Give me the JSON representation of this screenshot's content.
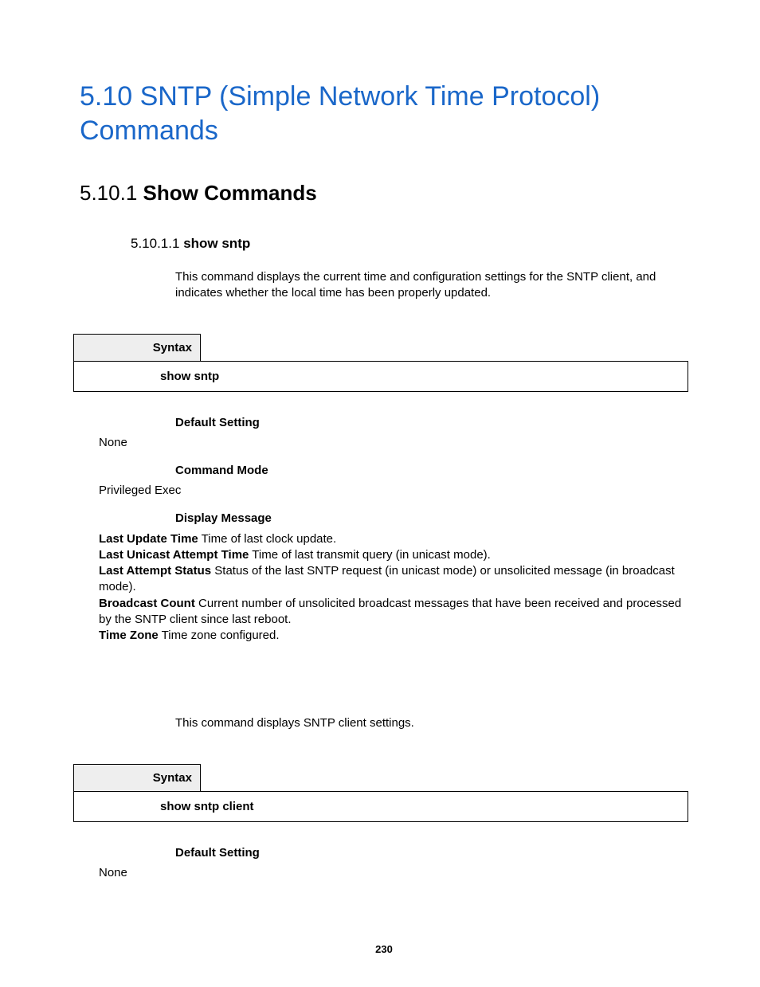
{
  "heading1": "5.10 SNTP (Simple Network Time Protocol) Commands",
  "heading2": {
    "num": "5.10.1",
    "title": "Show Commands"
  },
  "section1": {
    "heading3": {
      "num": "5.10.1.1",
      "title": "show sntp"
    },
    "desc": "This command displays the current time and configuration settings for the SNTP client, and indicates whether the local time has been properly updated.",
    "syntax_label": "Syntax",
    "syntax_text": "show sntp",
    "default_label": "Default Setting",
    "default_value": "None",
    "mode_label": "Command Mode",
    "mode_value": "Privileged Exec",
    "display_label": "Display Message",
    "messages": [
      {
        "term": "Last Update Time",
        "desc": "Time of last clock update."
      },
      {
        "term": "Last Unicast Attempt Time",
        "desc": "Time of last transmit query (in unicast mode)."
      },
      {
        "term": "Last Attempt Status",
        "desc": "Status of the last SNTP request (in unicast mode) or unsolicited message (in broadcast mode)."
      },
      {
        "term": "Broadcast Count",
        "desc": "Current number of unsolicited broadcast messages that have been received and processed by the SNTP client since last reboot."
      },
      {
        "term": "Time Zone",
        "desc": "Time zone configured."
      }
    ]
  },
  "section2": {
    "desc": "This command displays SNTP client settings.",
    "syntax_label": "Syntax",
    "syntax_text": "show sntp client",
    "default_label": "Default Setting",
    "default_value": "None"
  },
  "page_number": "230"
}
